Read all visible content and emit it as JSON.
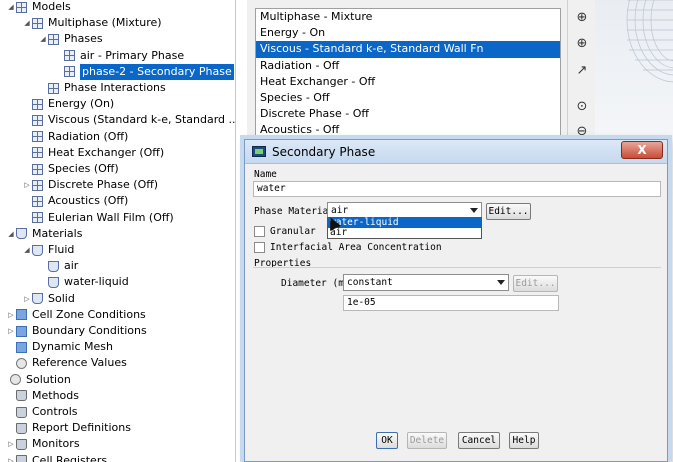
{
  "tree": {
    "items": [
      {
        "label": "Models",
        "indent": 0,
        "icon": "grid-icon",
        "twisty": "open"
      },
      {
        "label": "Multiphase (Mixture)",
        "indent": 1,
        "icon": "grid-icon",
        "twisty": "open"
      },
      {
        "label": "Phases",
        "indent": 2,
        "icon": "grid-icon",
        "twisty": "open"
      },
      {
        "label": "air - Primary Phase",
        "indent": 3,
        "icon": "grid-icon",
        "twisty": ""
      },
      {
        "label": "phase-2 - Secondary Phase",
        "indent": 3,
        "icon": "grid-icon",
        "twisty": "",
        "selected": true
      },
      {
        "label": "Phase Interactions",
        "indent": 2,
        "icon": "grid-icon",
        "twisty": ""
      },
      {
        "label": "Energy (On)",
        "indent": 1,
        "icon": "grid-icon",
        "twisty": ""
      },
      {
        "label": "Viscous (Standard k-e, Standard ...",
        "indent": 1,
        "icon": "grid-icon",
        "twisty": ""
      },
      {
        "label": "Radiation (Off)",
        "indent": 1,
        "icon": "grid-icon",
        "twisty": ""
      },
      {
        "label": "Heat Exchanger (Off)",
        "indent": 1,
        "icon": "grid-icon",
        "twisty": ""
      },
      {
        "label": "Species (Off)",
        "indent": 1,
        "icon": "grid-icon",
        "twisty": ""
      },
      {
        "label": "Discrete Phase (Off)",
        "indent": 1,
        "icon": "grid-icon",
        "twisty": "closed"
      },
      {
        "label": "Acoustics (Off)",
        "indent": 1,
        "icon": "grid-icon",
        "twisty": ""
      },
      {
        "label": "Eulerian Wall Film (Off)",
        "indent": 1,
        "icon": "grid-icon",
        "twisty": ""
      },
      {
        "label": "Materials",
        "indent": 0,
        "icon": "flask-icon",
        "twisty": "open"
      },
      {
        "label": "Fluid",
        "indent": 1,
        "icon": "flask-icon",
        "twisty": "open"
      },
      {
        "label": "air",
        "indent": 2,
        "icon": "flask-icon",
        "twisty": ""
      },
      {
        "label": "water-liquid",
        "indent": 2,
        "icon": "flask-icon",
        "twisty": ""
      },
      {
        "label": "Solid",
        "indent": 1,
        "icon": "flask-icon",
        "twisty": "closed"
      },
      {
        "label": "Cell Zone Conditions",
        "indent": 0,
        "icon": "cube-icon",
        "twisty": "closed"
      },
      {
        "label": "Boundary Conditions",
        "indent": 0,
        "icon": "cube-icon",
        "twisty": "closed"
      },
      {
        "label": "Dynamic Mesh",
        "indent": 0,
        "icon": "cube-icon",
        "twisty": ""
      },
      {
        "label": "Reference Values",
        "indent": 0,
        "icon": "gear-icon",
        "twisty": ""
      },
      {
        "label": "Solution",
        "indent": -1,
        "icon": "gear-icon",
        "twisty": ""
      },
      {
        "label": "Methods",
        "indent": 0,
        "icon": "beaker-icon",
        "twisty": ""
      },
      {
        "label": "Controls",
        "indent": 0,
        "icon": "beaker-icon",
        "twisty": ""
      },
      {
        "label": "Report Definitions",
        "indent": 0,
        "icon": "beaker-icon",
        "twisty": ""
      },
      {
        "label": "Monitors",
        "indent": 0,
        "icon": "beaker-icon",
        "twisty": "closed"
      },
      {
        "label": "Cell Registers",
        "indent": 0,
        "icon": "beaker-icon",
        "twisty": "closed"
      }
    ]
  },
  "models_list": {
    "items": [
      "Multiphase - Mixture",
      "Energy - On",
      "Viscous - Standard k-e, Standard Wall Fn",
      "Radiation - Off",
      "Heat Exchanger - Off",
      "Species - Off",
      "Discrete Phase - Off",
      "Acoustics - Off"
    ],
    "selected_index": 2
  },
  "tools": [
    "zoom-fit-icon",
    "zoom-in-icon",
    "probe-icon",
    "zoom-box-icon",
    "zoom-out-icon"
  ],
  "dialog": {
    "title": "Secondary Phase",
    "close_label": "X",
    "name_label": "Name",
    "name_value": "water",
    "phase_material_label": "Phase Material",
    "phase_material_value": "air",
    "edit_label": "Edit...",
    "dropdown_options": [
      "water-liquid",
      "air"
    ],
    "dropdown_selected_index": 0,
    "granular_label": "Granular",
    "granular_checked": false,
    "interfacial_label": "Interfacial Area Concentration",
    "interfacial_checked": false,
    "properties_label": "Properties",
    "diameter_label": "Diameter (m)",
    "diameter_method": "constant",
    "diameter_edit_label": "Edit...",
    "diameter_value": "1e-05",
    "buttons": {
      "ok": "OK",
      "delete": "Delete",
      "cancel": "Cancel",
      "help": "Help"
    }
  }
}
